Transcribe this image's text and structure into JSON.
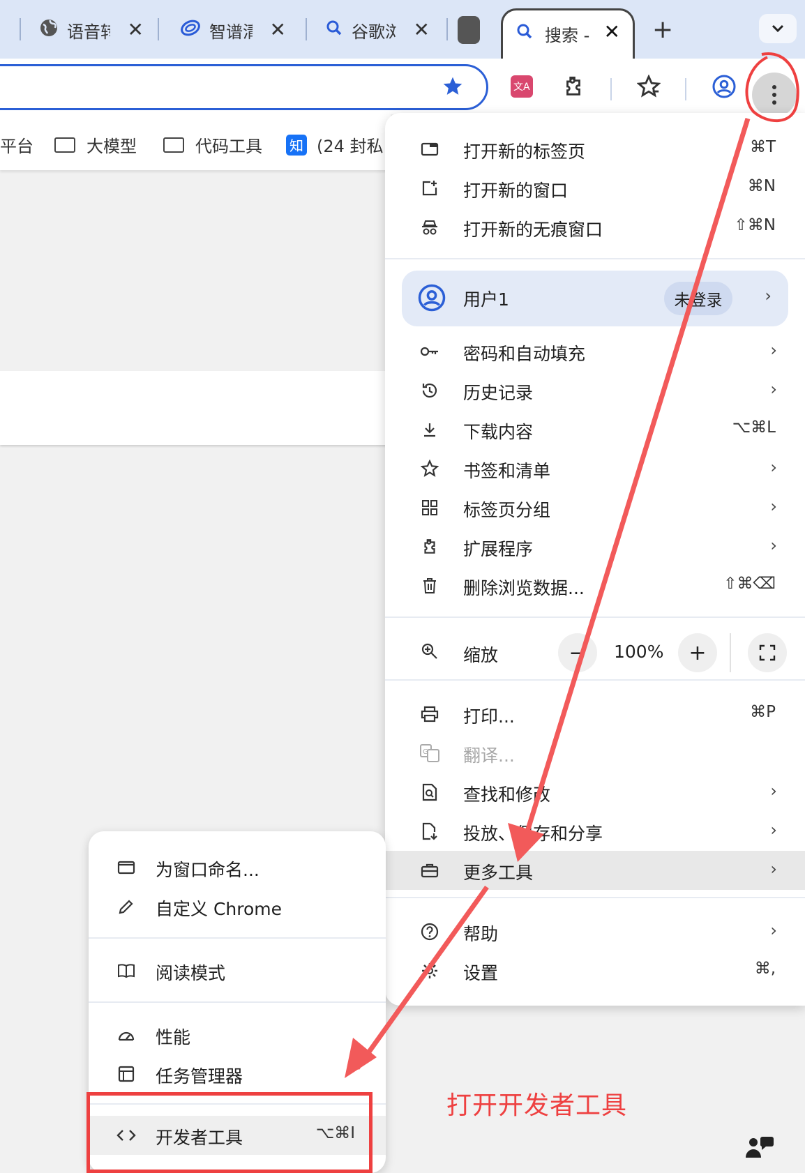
{
  "tabs": [
    {
      "label": "语音转",
      "icon": "globe-icon"
    },
    {
      "label": "智谱清",
      "icon": "zhipu-logo-icon"
    },
    {
      "label": "谷歌浏",
      "icon": "search-icon"
    },
    {
      "label": "",
      "icon": "blank-tab-icon"
    },
    {
      "label": "搜索 -",
      "icon": "search-icon",
      "active": true
    }
  ],
  "toolbar": {
    "new_tab": "+",
    "tab_menu": "⌄"
  },
  "bookmarks": [
    {
      "label": "平台"
    },
    {
      "label": "大模型"
    },
    {
      "label": "代码工具"
    },
    {
      "label": "(24 封私",
      "badge": "知"
    }
  ],
  "menu": {
    "group1": [
      {
        "label": "打开新的标签页",
        "shortcut": "⌘T",
        "icon": "new-tab-icon"
      },
      {
        "label": "打开新的窗口",
        "shortcut": "⌘N",
        "icon": "new-window-icon"
      },
      {
        "label": "打开新的无痕窗口",
        "shortcut": "⇧⌘N",
        "icon": "incognito-icon"
      }
    ],
    "profile": {
      "label": "用户1",
      "badge": "未登录"
    },
    "group2": [
      {
        "label": "密码和自动填充",
        "chevron": true,
        "icon": "key-icon"
      },
      {
        "label": "历史记录",
        "chevron": true,
        "icon": "history-icon"
      },
      {
        "label": "下载内容",
        "shortcut": "⌥⌘L",
        "icon": "download-icon"
      },
      {
        "label": "书签和清单",
        "chevron": true,
        "icon": "star-icon"
      },
      {
        "label": "标签页分组",
        "chevron": true,
        "icon": "tab-groups-icon"
      },
      {
        "label": "扩展程序",
        "chevron": true,
        "icon": "extension-icon"
      },
      {
        "label": "删除浏览数据...",
        "shortcut": "⇧⌘⌫",
        "icon": "trash-icon"
      }
    ],
    "zoom": {
      "label": "缩放",
      "minus": "−",
      "value": "100%",
      "plus": "+"
    },
    "group3": [
      {
        "label": "打印...",
        "shortcut": "⌘P",
        "icon": "print-icon"
      },
      {
        "label": "翻译...",
        "disabled": true,
        "icon": "translate-icon"
      },
      {
        "label": "查找和修改",
        "chevron": true,
        "icon": "find-icon"
      },
      {
        "label": "投放、保存和分享",
        "chevron": true,
        "icon": "cast-save-icon"
      },
      {
        "label": "更多工具",
        "chevron": true,
        "icon": "toolbox-icon",
        "highlight": true
      }
    ],
    "group4": [
      {
        "label": "帮助",
        "chevron": true,
        "icon": "help-icon"
      },
      {
        "label": "设置",
        "shortcut": "⌘,",
        "icon": "gear-icon"
      }
    ]
  },
  "chevron_glyph": "›",
  "submenu": [
    {
      "label": "为窗口命名...",
      "icon": "window-icon"
    },
    {
      "label": "自定义 Chrome",
      "icon": "pencil-icon"
    },
    {
      "label": "阅读模式",
      "icon": "book-icon"
    },
    {
      "label": "性能",
      "icon": "speedometer-icon"
    },
    {
      "label": "任务管理器",
      "icon": "task-manager-icon"
    },
    {
      "label": "开发者工具",
      "shortcut": "⌥⌘I",
      "icon": "code-icon",
      "highlight": true
    }
  ],
  "annotation": {
    "text": "打开开发者工具",
    "color": "#ee4040"
  },
  "colors": {
    "accent": "#2b5fd6",
    "annotation": "#ee4040",
    "tabstrip": "#dce6f7"
  }
}
